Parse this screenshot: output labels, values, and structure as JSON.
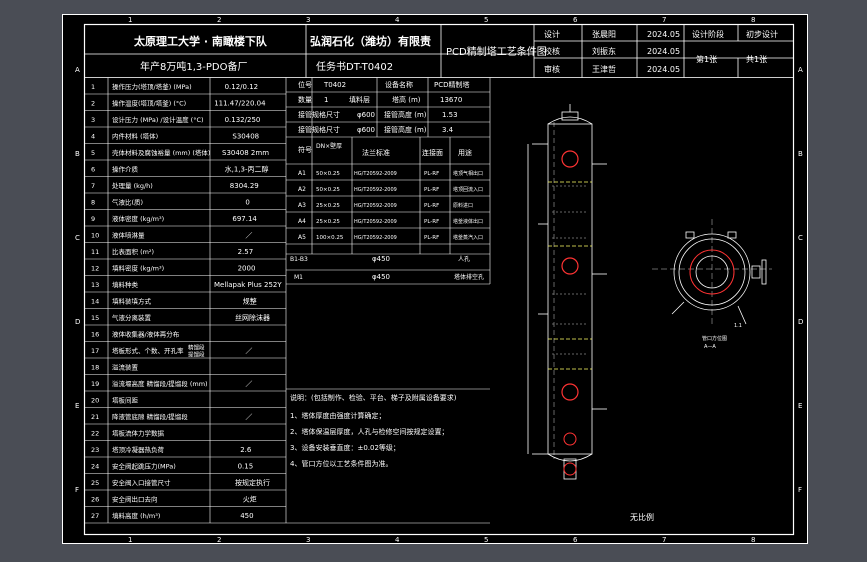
{
  "title_block": {
    "school": "太原理工大学 · 南瞰楼下队",
    "company": "弘润石化（潍坊）有限责",
    "drawing_title": "PCD精制塔工艺条件图",
    "project": "年产8万吨1,3-PDO备厂",
    "task_no": "任务书DT-T0402",
    "rows": [
      {
        "role": "设计",
        "name": "张晨阳",
        "date": "2024.05"
      },
      {
        "role": "校核",
        "name": "刘振东",
        "date": "2024.05"
      },
      {
        "role": "审核",
        "name": "王津哲",
        "date": "2024.05"
      }
    ],
    "stage_label": "设计阶段",
    "stage_value": "初步设计",
    "sheet_no": "第1张",
    "sheet_total": "共1张"
  },
  "spec_rows": [
    {
      "no": "1",
      "label": "操作压力(塔顶/塔釜) (MPa)",
      "value": "0.12/0.12"
    },
    {
      "no": "2",
      "label": "操作温度(塔顶/塔釜) (°C)",
      "value": "111.47/220.04"
    },
    {
      "no": "3",
      "label": "设计压力 (MPa) /设计温度 (°C)",
      "value": "0.132/250"
    },
    {
      "no": "4",
      "label": "内件材料 (塔体)",
      "value": "S30408"
    },
    {
      "no": "5",
      "label": "壳体材料及腐蚀裕量 (mm) (塔体)",
      "value": "S30408 2mm"
    },
    {
      "no": "6",
      "label": "操作介质",
      "value": "水,1,3-丙二醇"
    },
    {
      "no": "7",
      "label": "处理量 (kg/h)",
      "value": "8304.29"
    },
    {
      "no": "8",
      "label": "气液比(质)",
      "value": "0"
    },
    {
      "no": "9",
      "label": "液体密度 (kg/m³)",
      "value": "697.14"
    },
    {
      "no": "10",
      "label": "液体喷淋量",
      "value": "／"
    },
    {
      "no": "11",
      "label": "比表面积 (m²)",
      "value": "2.57"
    },
    {
      "no": "12",
      "label": "填料密度 (kg/m³)",
      "value": "2000"
    },
    {
      "no": "13",
      "label": "填料种类",
      "value": "Mellapak Plus 252Y"
    },
    {
      "no": "14",
      "label": "填料装填方式",
      "value": "规整"
    },
    {
      "no": "15",
      "label": "气液分离装置",
      "value": "丝网除沫器"
    },
    {
      "no": "16",
      "label": "液体收集器/液体再分布",
      "value": ""
    },
    {
      "no": "17",
      "label": "塔板形式、个数、开孔率",
      "value": "／",
      "sub1": "精馏段",
      "sub2": "提馏段"
    },
    {
      "no": "18",
      "label": "溢流装置",
      "value": ""
    },
    {
      "no": "19",
      "label": "溢流堰高度 精馏段/提馏段 (mm)",
      "value": "／"
    },
    {
      "no": "20",
      "label": "塔板间距",
      "value": ""
    },
    {
      "no": "21",
      "label": "降液管底隙 精馏段/提馏段",
      "value": "／"
    },
    {
      "no": "22",
      "label": "塔板流体力学数据",
      "value": ""
    },
    {
      "no": "23",
      "label": "塔顶冷凝器热负荷",
      "value": "2.6"
    },
    {
      "no": "24",
      "label": "安全阀起跳压力(MPa)",
      "value": "0.15"
    },
    {
      "no": "25",
      "label": "安全阀入口接管尺寸",
      "value": "按规定执行"
    },
    {
      "no": "26",
      "label": "安全阀出口去向",
      "value": "火炬"
    },
    {
      "no": "27",
      "label": "填料高度 (h/m³)",
      "value": "450"
    }
  ],
  "right_info": {
    "r1": {
      "k1": "位号",
      "v1": "T0402",
      "k2": "设备名称",
      "v2": "PCD精制塔"
    },
    "r2": {
      "k1": "数量",
      "v1": "1",
      "k2": "填料层",
      "v3": "塔高 (m)",
      "v4": "13670"
    },
    "r3": {
      "k": "接管规格尺寸",
      "v": "φ600",
      "k2": "接管高度 (m)",
      "v2": "1.53"
    },
    "r4": {
      "k": "接管规格尺寸",
      "v": "φ600",
      "k2": "接管高度 (m)",
      "v2": "3.4"
    },
    "nozzle_head": {
      "c1": "符号",
      "c2": "DN×壁厚",
      "c3": "法兰标准",
      "c4": "连接面",
      "c5": "用途"
    },
    "nozzles": [
      {
        "sym": "A1",
        "dn": "50×0.25",
        "std": "HG/T20592-2009",
        "face": "PL-RF",
        "use": "塔顶气相出口"
      },
      {
        "sym": "A2",
        "dn": "50×0.25",
        "std": "HG/T20592-2009",
        "face": "PL-RF",
        "use": "塔顶回流入口"
      },
      {
        "sym": "A3",
        "dn": "25×0.25",
        "std": "HG/T20592-2009",
        "face": "PL-RF",
        "use": "原料进口"
      },
      {
        "sym": "A4",
        "dn": "25×0.25",
        "std": "HG/T20592-2009",
        "face": "PL-RF",
        "use": "塔釜液体出口"
      },
      {
        "sym": "A5",
        "dn": "100×0.25",
        "std": "HG/T20592-2009",
        "face": "PL-RF",
        "use": "塔釜蒸汽入口"
      }
    ],
    "manhole_row1": {
      "sym": "B1-B3",
      "v": "φ450",
      "use": "人孔"
    },
    "manhole_row2": {
      "sym": "M1",
      "v": "φ450",
      "use": "塔体排空孔"
    }
  },
  "notes": {
    "head": "说明：(包括制作、检验、平台、梯子及附属设备要求)",
    "items": [
      "1、塔体厚度由强度计算确定；",
      "2、塔体保温层厚度，人孔与检修空间按规定设置；",
      "3、设备安装垂直度：±0.02等级；",
      "4、管口方位以工艺条件图为准。"
    ]
  },
  "drawing_labels": {
    "orientation": "管口方位图",
    "scale": "无比例",
    "section": "A—A",
    "dim": "1.1"
  },
  "grid_letters": [
    "A",
    "B",
    "C",
    "D",
    "E",
    "F"
  ],
  "grid_numbers": [
    "1",
    "2",
    "3",
    "4",
    "5",
    "6",
    "7",
    "8"
  ]
}
